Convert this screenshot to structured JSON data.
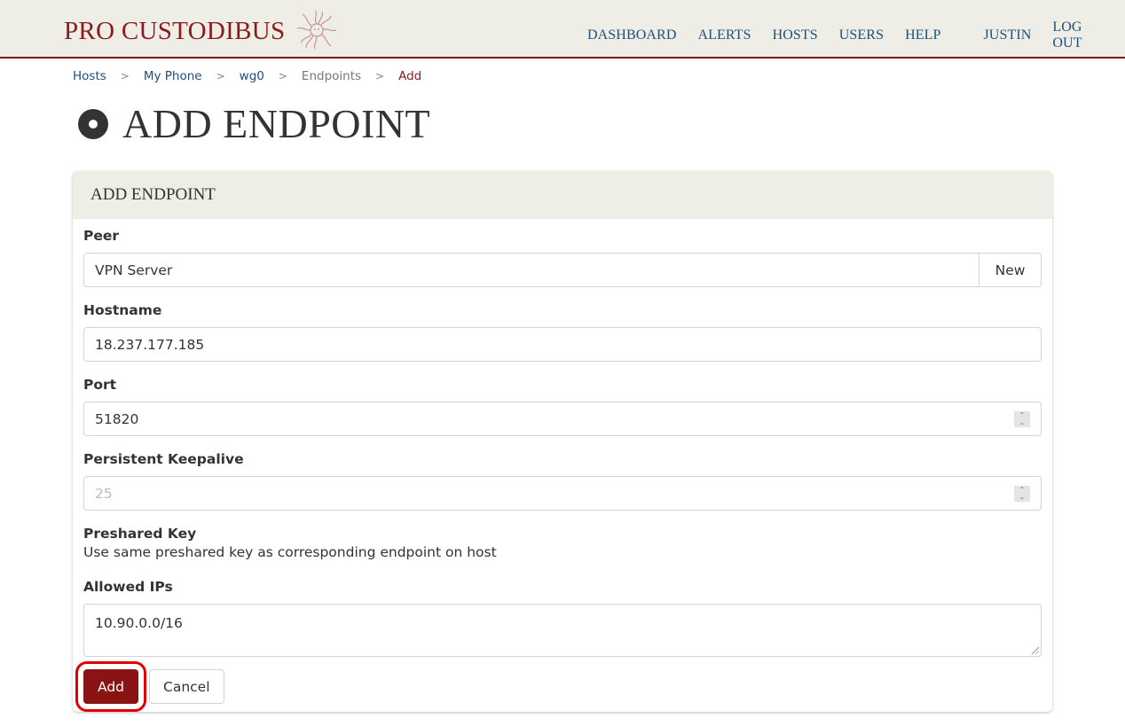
{
  "header": {
    "brand": "PRO CUSTODIBUS",
    "logo_icon": "medusa-logo-icon",
    "nav": [
      {
        "label": "DASHBOARD"
      },
      {
        "label": "ALERTS"
      },
      {
        "label": "HOSTS"
      },
      {
        "label": "USERS"
      },
      {
        "label": "HELP"
      }
    ],
    "user": "JUSTIN",
    "logout": "LOG OUT"
  },
  "breadcrumb": [
    {
      "label": "Hosts"
    },
    {
      "label": "My Phone"
    },
    {
      "label": "wg0"
    },
    {
      "label": "Endpoints"
    },
    {
      "label": "Add"
    }
  ],
  "breadcrumb_separator": ">",
  "page": {
    "title": "ADD ENDPOINT",
    "title_icon": "endpoint-circle-icon"
  },
  "form": {
    "header": "ADD ENDPOINT",
    "peer": {
      "label": "Peer",
      "value": "VPN Server",
      "new_button": "New"
    },
    "hostname": {
      "label": "Hostname",
      "value": "18.237.177.185"
    },
    "port": {
      "label": "Port",
      "value": "51820"
    },
    "keepalive": {
      "label": "Persistent Keepalive",
      "placeholder": "25"
    },
    "preshared_key": {
      "label": "Preshared Key",
      "help": "Use same preshared key as corresponding endpoint on host"
    },
    "allowed_ips": {
      "label": "Allowed IPs",
      "value": "10.90.0.0/16"
    },
    "submit": "Add",
    "cancel": "Cancel"
  },
  "colors": {
    "brand": "#8a1c1c",
    "nav_link": "#1f4f7a",
    "header_bg": "#eeede6",
    "primary_button": "#8a1414",
    "highlight": "#e00000"
  }
}
